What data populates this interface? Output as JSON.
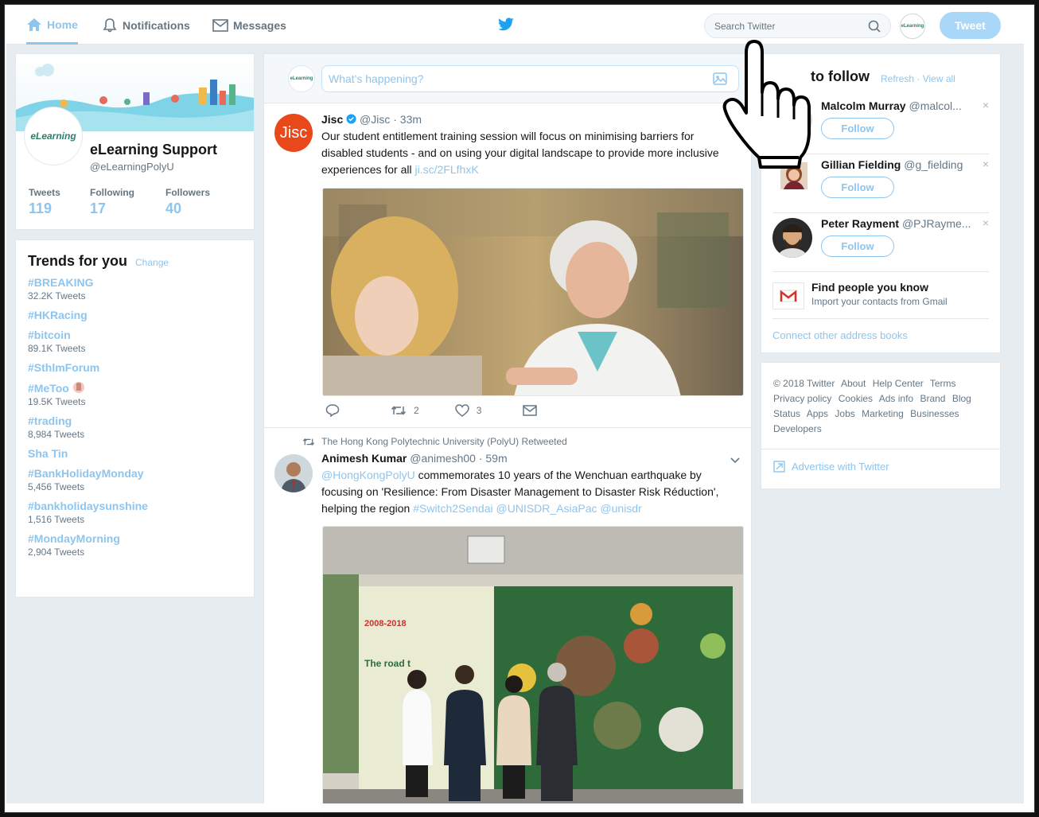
{
  "nav": {
    "home": "Home",
    "notifications": "Notifications",
    "messages": "Messages"
  },
  "search": {
    "placeholder": "Search Twitter"
  },
  "tweet_button": "Tweet",
  "profile": {
    "avatar_text": "eLearning",
    "name": "eLearning Support",
    "handle": "@eLearningPolyU",
    "stats": [
      {
        "label": "Tweets",
        "value": "119"
      },
      {
        "label": "Following",
        "value": "17"
      },
      {
        "label": "Followers",
        "value": "40"
      }
    ]
  },
  "trends": {
    "title": "Trends for you",
    "change": "Change",
    "items": [
      {
        "tag": "#BREAKING",
        "count": "32.2K Tweets"
      },
      {
        "tag": "#HKRacing",
        "count": ""
      },
      {
        "tag": "#bitcoin",
        "count": "89.1K Tweets"
      },
      {
        "tag": "#SthlmForum",
        "count": ""
      },
      {
        "tag": "#MeToo",
        "count": "19.5K Tweets"
      },
      {
        "tag": "#trading",
        "count": "8,984 Tweets"
      },
      {
        "tag": "Sha Tin",
        "count": ""
      },
      {
        "tag": "#BankHolidayMonday",
        "count": "5,456 Tweets"
      },
      {
        "tag": "#bankholidaysunshine",
        "count": "1,516 Tweets"
      },
      {
        "tag": "#MondayMorning",
        "count": "2,904 Tweets"
      }
    ]
  },
  "composer": {
    "placeholder": "What's happening?",
    "avatar_text": "eLearning"
  },
  "tweets": [
    {
      "avatar_text": "Jisc",
      "name": "Jisc",
      "handle": "@Jisc",
      "time": "· 33m",
      "text_lines": [
        "Our student entitlement training session will focus on minimising barriers for",
        "disabled students - and on using your digital landscape to provide more inclusive",
        "experiences for all"
      ],
      "link": "ji.sc/2FLfhxK",
      "retweets": "2",
      "likes": "3"
    },
    {
      "retweeted_by": "The Hong Kong Polytechnic University (PolyU) Retweeted",
      "name": "Animesh Kumar",
      "handle": "@animesh00",
      "time": "· 59m",
      "mention": "@HongKongPolyU",
      "text_1": " commemorates 10 years of the Wenchuan earthquake by",
      "text_2": "focusing on 'Resilience: From Disaster Management to Disaster Risk Réduction',",
      "text_3": "helping the region ",
      "tags": "#Switch2Sendai @UNISDR_AsiaPac @unisdr",
      "poster_year": "2008-2018",
      "poster_road": "The road t"
    }
  ],
  "who_to_follow": {
    "title": "to follow",
    "refresh": "Refresh",
    "sep": " · ",
    "view_all": "View all",
    "follow_label": "Follow",
    "close": "×",
    "people": [
      {
        "name": "Malcolm Murray",
        "handle": "@malcol..."
      },
      {
        "name": "Gillian Fielding",
        "handle": "@g_fielding"
      },
      {
        "name": "Peter Rayment",
        "handle": "@PJRayme..."
      }
    ],
    "find_title": "Find people you know",
    "find_sub": "Import your contacts from Gmail",
    "connect": "Connect other address books"
  },
  "footer": {
    "links": [
      "© 2018 Twitter",
      "About",
      "Help Center",
      "Terms",
      "Privacy policy",
      "Cookies",
      "Ads info",
      "Brand",
      "Blog",
      "Status",
      "Apps",
      "Jobs",
      "Marketing",
      "Businesses",
      "Developers"
    ],
    "advertise": "Advertise with Twitter"
  },
  "colors": {
    "accent": "#8ec5ee",
    "tweet_button": "#a9d7f7",
    "background": "#e6ecf0",
    "jisc": "#e9491a"
  },
  "icons": [
    "home-icon",
    "bell-icon",
    "envelope-icon",
    "twitter-bird-icon",
    "search-icon",
    "image-icon",
    "reply-icon",
    "retweet-icon",
    "heart-icon",
    "dm-icon",
    "chevron-down-icon",
    "gmail-icon",
    "advertise-icon",
    "pointer-hand-icon"
  ]
}
